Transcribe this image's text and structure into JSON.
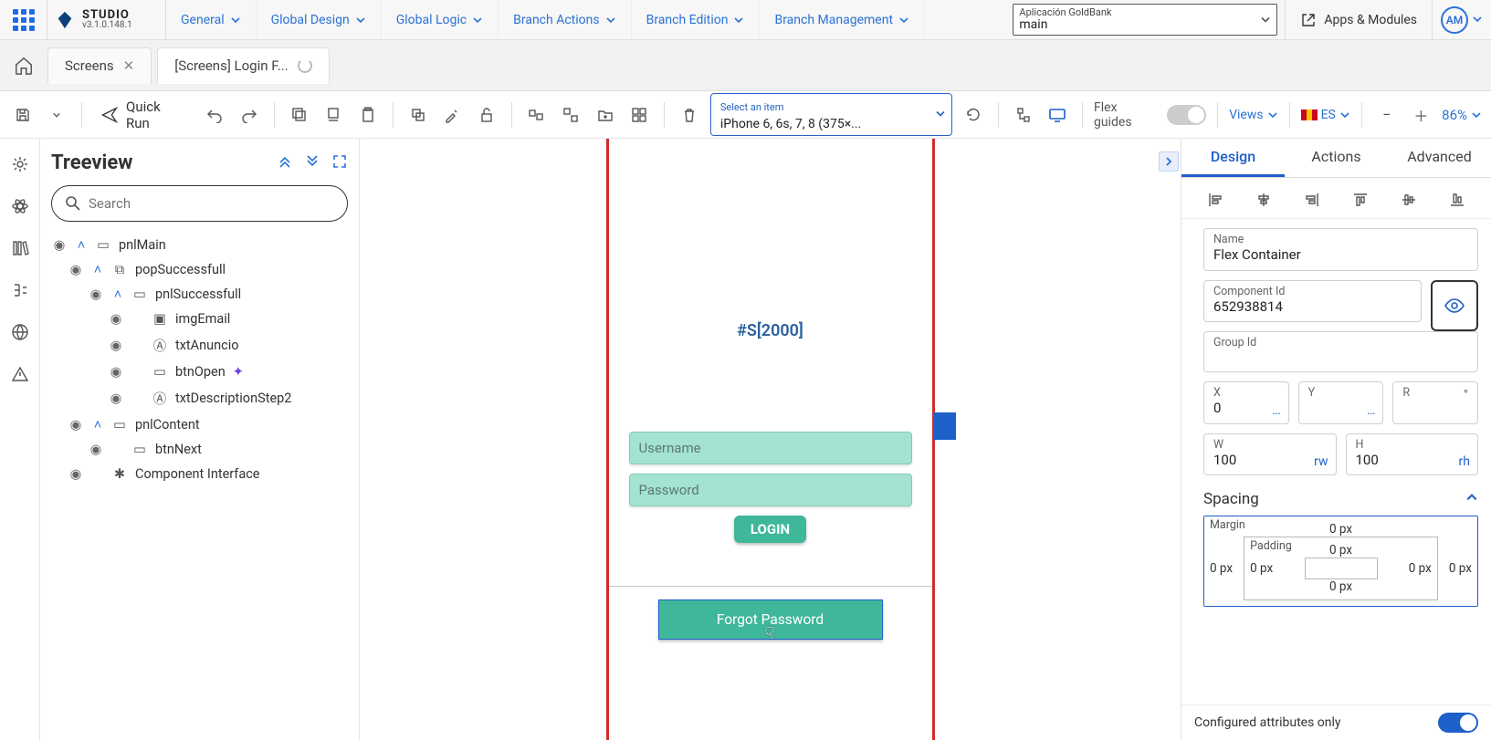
{
  "brand": {
    "name": "STUDIO",
    "version": "v3.1.0.148.1"
  },
  "menus": [
    "General",
    "Global Design",
    "Global Logic",
    "Branch Actions",
    "Branch Edition",
    "Branch Management"
  ],
  "project": {
    "label": "Aplicación GoldBank",
    "branch": "main"
  },
  "appsModules": "Apps & Modules",
  "user": "AM",
  "tabs": [
    {
      "label": "Screens",
      "status": "idle"
    },
    {
      "label": "[Screens] Login F...",
      "status": "loading"
    }
  ],
  "toolbar": {
    "quick_run": "Quick Run",
    "device_label": "Select an item",
    "device_value": "iPhone 6, 6s, 7, 8 (375×...",
    "flex_guides": "Flex guides",
    "views": "Views",
    "lang": "ES",
    "zoom": "86%"
  },
  "treeview": {
    "title": "Treeview",
    "search_placeholder": "Search",
    "nodes": {
      "pnlMain": "pnlMain",
      "popSuccessfull": "popSuccessfull",
      "pnlSuccessfull": "pnlSuccessfull",
      "imgEmail": "imgEmail",
      "txtAnuncio": "txtAnuncio",
      "btnOpen": "btnOpen",
      "txtDescriptionStep2": "txtDescriptionStep2",
      "pnlContent": "pnlContent",
      "btnNext": "btnNext",
      "componentInterface": "Component Interface"
    }
  },
  "canvas": {
    "app_title": "#S[2000]",
    "username_placeholder": "Username",
    "password_placeholder": "Password",
    "login_label": "LOGIN",
    "forgot_label": "Forgot Password"
  },
  "props": {
    "tabs": {
      "design": "Design",
      "actions": "Actions",
      "advanced": "Advanced"
    },
    "name_label": "Name",
    "name_value": "Flex Container",
    "component_id_label": "Component Id",
    "component_id_value": "652938814",
    "group_id_label": "Group Id",
    "group_id_value": "",
    "x_label": "X",
    "x_value": "0",
    "x_unit": "…",
    "y_label": "Y",
    "y_value": "",
    "y_unit": "…",
    "r_label": "R",
    "r_value": "",
    "w_label": "W",
    "w_value": "100",
    "w_unit": "rw",
    "h_label": "H",
    "h_value": "100",
    "h_unit": "rh",
    "spacing_title": "Spacing",
    "margin_label": "Margin",
    "padding_label": "Padding",
    "margin_top": "0  px",
    "margin_right": "0  px",
    "margin_bottom": "",
    "margin_left": "0  px",
    "padding_top": "0  px",
    "padding_right": "0  px",
    "padding_bottom": "0  px",
    "padding_left": "0  px",
    "configured_only": "Configured attributes only"
  }
}
